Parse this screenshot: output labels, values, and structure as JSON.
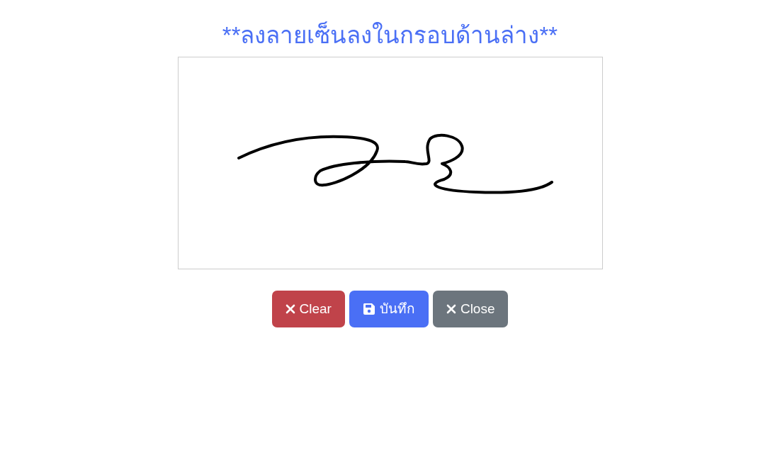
{
  "title": "**ลงลายเซ็นลงในกรอบด้านล่าง**",
  "signature_pad": {
    "kind": "signed"
  },
  "buttons": [
    {
      "label": "Clear",
      "kind": "danger"
    },
    {
      "label": "บันทึก",
      "kind": "primary"
    },
    {
      "label": "Close",
      "kind": "secondary"
    }
  ]
}
